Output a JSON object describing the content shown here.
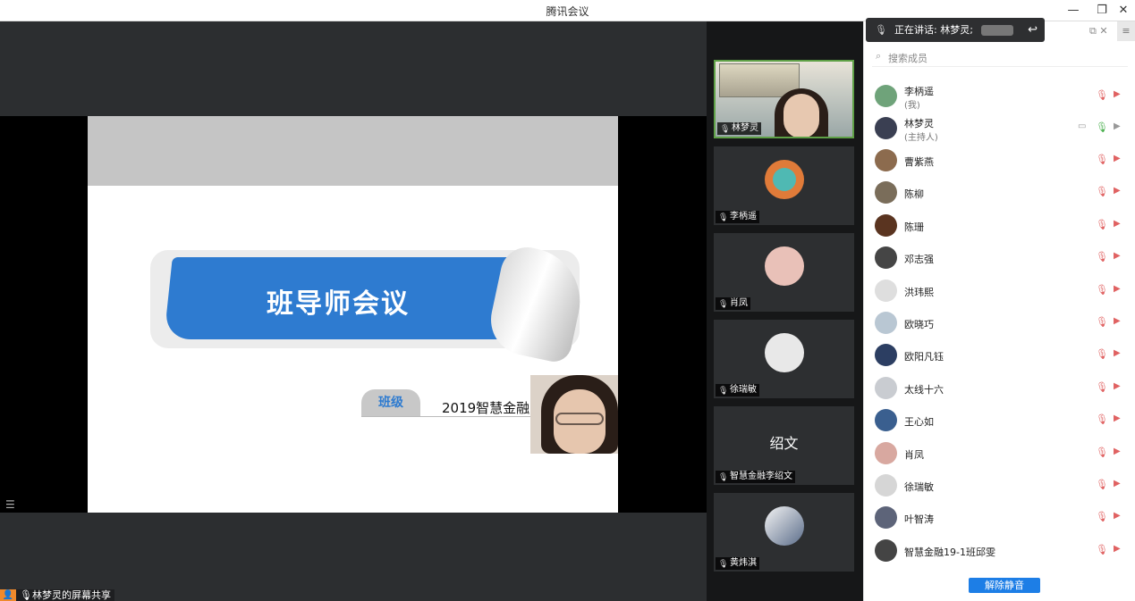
{
  "window": {
    "title": "腾讯会议",
    "minimize": "—",
    "restore": "❐",
    "close": "✕"
  },
  "share": {
    "slide_title": "班导师会议",
    "class_label": "班级",
    "class_value": "2019智慧金融",
    "share_label": "林梦灵的屏幕共享",
    "list_icon": "☰"
  },
  "video_tiles": [
    {
      "name": "林梦灵",
      "active": true
    },
    {
      "name": "李柄遥"
    },
    {
      "name": "肖凤"
    },
    {
      "name": "徐瑞敏"
    },
    {
      "name": "智慧金融李绍文",
      "text_avatar": "绍文"
    },
    {
      "name": "黄炜淇"
    }
  ],
  "panel": {
    "speaking_label": "正在讲话: 林梦灵;",
    "search_placeholder": "搜索成员",
    "unmute_all": "解除静音",
    "participants": [
      {
        "name": "李柄遥",
        "role": "(我)",
        "color": "#6fa37a"
      },
      {
        "name": "林梦灵",
        "role": "(主持人)",
        "color": "#3a3f52"
      },
      {
        "name": "曹紫燕",
        "color": "#8c6b4e"
      },
      {
        "name": "陈柳",
        "color": "#7a6d5a"
      },
      {
        "name": "陈珊",
        "color": "#5a3420"
      },
      {
        "name": "邓志强",
        "color": "#454545"
      },
      {
        "name": "洪玮熙",
        "color": "#dedede"
      },
      {
        "name": "欧晓巧",
        "color": "#b9c7d3"
      },
      {
        "name": "欧阳凡钰",
        "color": "#2c3e62"
      },
      {
        "name": "太线十六",
        "color": "#c9ccd1"
      },
      {
        "name": "王心如",
        "color": "#3a5f8f"
      },
      {
        "name": "肖凤",
        "color": "#d8a8a0"
      },
      {
        "name": "徐瑞敏",
        "color": "#d6d6d6"
      },
      {
        "name": "叶智涛",
        "color": "#5d6479"
      },
      {
        "name": "智慧金融19-1班邱雯",
        "color": "#444444"
      }
    ]
  },
  "icons": {
    "mic": "🎙",
    "mic_off": "🎙̸",
    "cam_off": "▶",
    "search": "⌕",
    "reply": "↩",
    "menu": "≡"
  }
}
